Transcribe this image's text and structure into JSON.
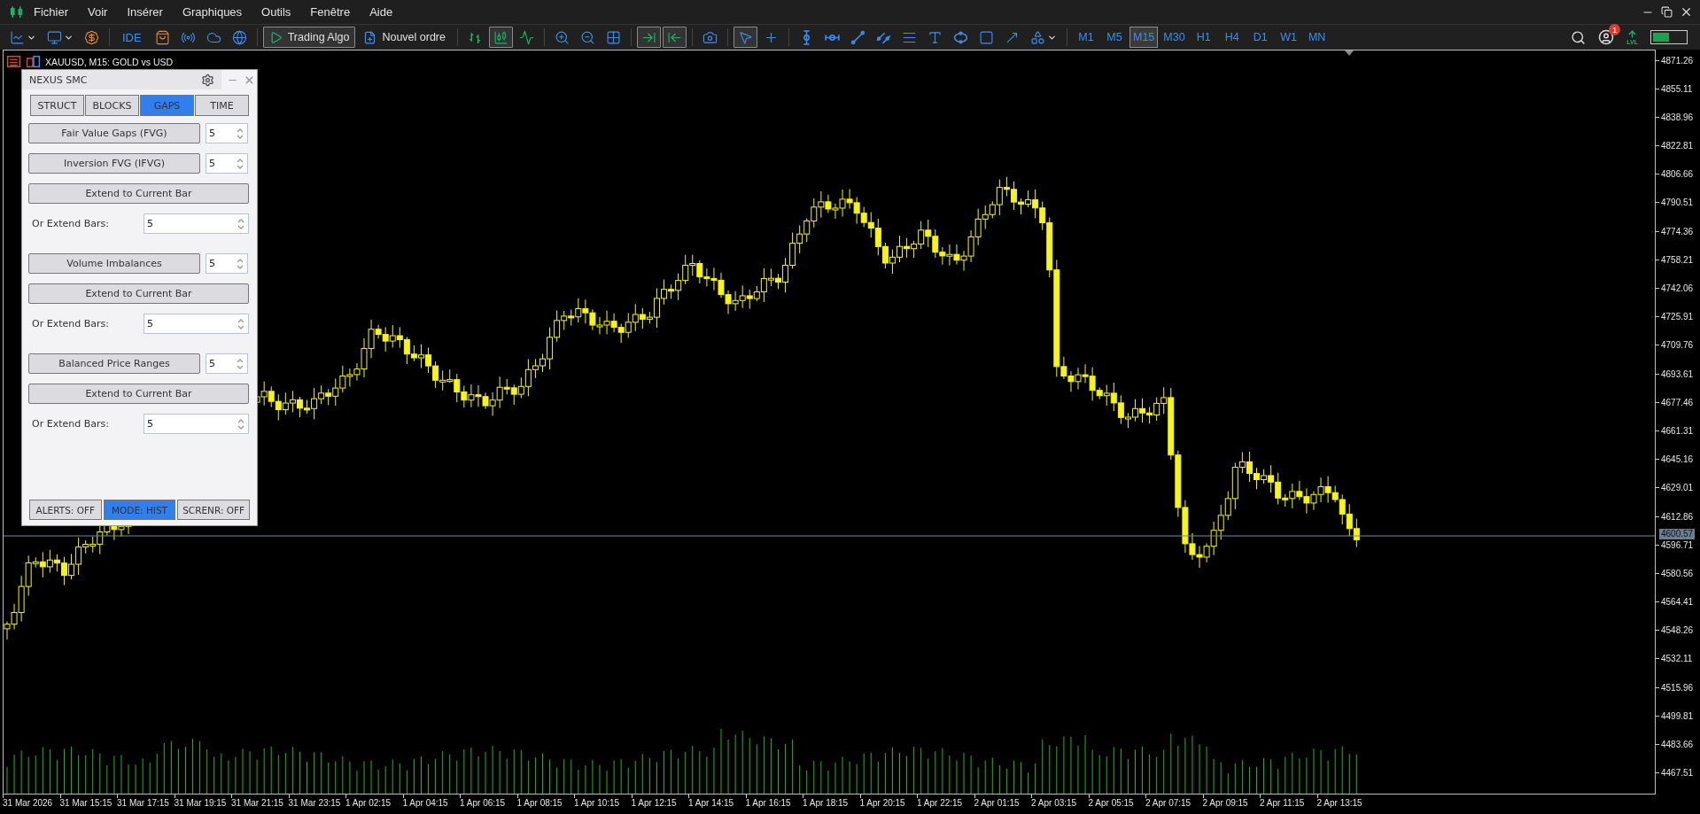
{
  "menu": [
    "Fichier",
    "Voir",
    "Insérer",
    "Graphiques",
    "Outils",
    "Fenêtre",
    "Aide"
  ],
  "toolbar": {
    "groups": [
      [
        {
          "kind": "icon",
          "selected": false
        },
        {
          "kind": "icon",
          "selected": false
        },
        {
          "kind": "icon",
          "selected": false
        }
      ],
      [
        {
          "kind": "text",
          "label": "IDE"
        },
        {
          "kind": "icon",
          "selected": false
        },
        {
          "kind": "icon",
          "selected": false
        },
        {
          "kind": "icon",
          "selected": false
        },
        {
          "kind": "icon",
          "selected": false
        }
      ],
      [
        {
          "kind": "button",
          "label": "Trading Algo",
          "selected": true
        },
        {
          "kind": "button",
          "label": "Nouvel ordre",
          "selected": false
        }
      ],
      [
        {
          "kind": "icon",
          "selected": false
        },
        {
          "kind": "icon",
          "selected": true
        },
        {
          "kind": "icon",
          "selected": false
        }
      ],
      [
        {
          "kind": "icon",
          "selected": false
        },
        {
          "kind": "icon",
          "selected": false
        },
        {
          "kind": "icon",
          "selected": false
        }
      ],
      [
        {
          "kind": "icon",
          "selected": true
        },
        {
          "kind": "icon",
          "selected": true
        }
      ],
      [
        {
          "kind": "icon",
          "selected": false
        }
      ],
      [
        {
          "kind": "icon",
          "selected": true
        },
        {
          "kind": "icon",
          "selected": false
        }
      ],
      [
        {
          "kind": "icon",
          "selected": false
        },
        {
          "kind": "icon",
          "selected": false
        },
        {
          "kind": "icon",
          "selected": false
        },
        {
          "kind": "icon",
          "selected": false
        },
        {
          "kind": "icon",
          "selected": false
        },
        {
          "kind": "icon",
          "selected": false
        },
        {
          "kind": "icon",
          "selected": false
        },
        {
          "kind": "icon",
          "selected": false
        },
        {
          "kind": "icon",
          "selected": false
        },
        {
          "kind": "icon",
          "selected": false
        }
      ]
    ],
    "timeframes": [
      {
        "label": "M1",
        "selected": false
      },
      {
        "label": "M5",
        "selected": false
      },
      {
        "label": "M15",
        "selected": true
      },
      {
        "label": "M30",
        "selected": false
      },
      {
        "label": "H1",
        "selected": false
      },
      {
        "label": "H4",
        "selected": false
      },
      {
        "label": "D1",
        "selected": false
      },
      {
        "label": "W1",
        "selected": false
      },
      {
        "label": "MN",
        "selected": false
      }
    ],
    "notification_badge": "1",
    "level_label": "LVL",
    "level": 0.5
  },
  "chart": {
    "title": "XAUUSD, M15:  GOLD vs USD",
    "price_labels": [
      "4871.26",
      "4855.11",
      "4838.96",
      "4822.81",
      "4806.66",
      "4790.51",
      "4774.36",
      "4758.21",
      "4742.06",
      "4725.91",
      "4709.76",
      "4693.61",
      "4677.46",
      "4661.31",
      "4645.16",
      "4629.01",
      "4612.86",
      "4596.71",
      "4580.56",
      "4564.41",
      "4548.26",
      "4532.11",
      "4515.96",
      "4499.81",
      "4483.66",
      "4467.51"
    ],
    "current_price": "4600.57",
    "time_labels": [
      "31 Mar 2026",
      "31 Mar 15:15",
      "31 Mar 17:15",
      "31 Mar 19:15",
      "31 Mar 21:15",
      "31 Mar 23:15",
      "1 Apr 02:15",
      "1 Apr 04:15",
      "1 Apr 06:15",
      "1 Apr 08:15",
      "1 Apr 10:15",
      "1 Apr 12:15",
      "1 Apr 14:15",
      "1 Apr 16:15",
      "1 Apr 18:15",
      "1 Apr 20:15",
      "1 Apr 22:15",
      "2 Apr 01:15",
      "2 Apr 03:15",
      "2 Apr 05:15",
      "2 Apr 07:15",
      "2 Apr 09:15",
      "2 Apr 11:15",
      "2 Apr 13:15"
    ]
  },
  "panel": {
    "title": "NEXUS SMC",
    "tabs": [
      {
        "label": "STRUCT",
        "selected": false
      },
      {
        "label": "BLOCKS",
        "selected": false
      },
      {
        "label": "GAPS",
        "selected": true
      },
      {
        "label": "TIME",
        "selected": false
      }
    ],
    "groups": [
      [
        {
          "kind": "toggle",
          "label": "Fair Value Gaps (FVG)",
          "value": "5"
        },
        {
          "kind": "toggle",
          "label": "Inversion FVG (IFVG)",
          "value": "5"
        },
        {
          "kind": "wide",
          "label": "Extend to Current Bar"
        },
        {
          "kind": "bars",
          "label": "Or Extend Bars:",
          "value": "5"
        }
      ],
      [
        {
          "kind": "toggle",
          "label": "Volume Imbalances",
          "value": "5"
        },
        {
          "kind": "wide",
          "label": "Extend to Current Bar"
        },
        {
          "kind": "bars",
          "label": "Or Extend Bars:",
          "value": "5"
        }
      ],
      [
        {
          "kind": "toggle",
          "label": "Balanced Price Ranges",
          "value": "5"
        },
        {
          "kind": "wide",
          "label": "Extend to Current Bar"
        },
        {
          "kind": "bars",
          "label": "Or Extend Bars:",
          "value": "5"
        }
      ]
    ],
    "footer": [
      {
        "label": "ALERTS: OFF",
        "selected": false
      },
      {
        "label": "MODE: HIST",
        "selected": true
      },
      {
        "label": "SCRENR: OFF",
        "selected": false
      }
    ]
  }
}
